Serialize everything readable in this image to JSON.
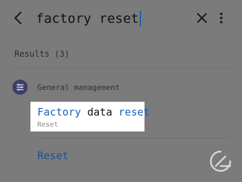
{
  "search": {
    "query_part1": "factory",
    "query_part2": " reset"
  },
  "results": {
    "count_label": "Results (3)"
  },
  "category": {
    "label": "General management",
    "icon": "sliders-icon"
  },
  "result1": {
    "title_part1": "Factory",
    "title_part2": " data ",
    "title_part3": "reset",
    "subtitle": "Reset"
  },
  "result2": {
    "title": "Reset"
  },
  "icons": {
    "back": "back-arrow-icon",
    "clear": "close-icon",
    "more": "more-vertical-icon",
    "watermark": "gadget-logo-icon"
  },
  "colors": {
    "background": "#7b7b7b",
    "highlight": "#1d5fb8",
    "category_icon_bg": "#3c4066"
  }
}
